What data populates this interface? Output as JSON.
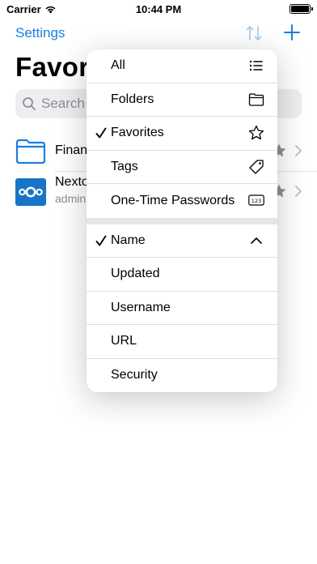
{
  "status_bar": {
    "carrier": "Carrier",
    "time": "10:44 PM"
  },
  "nav": {
    "left_label": "Settings",
    "sort_icon": "sort-arrows-icon",
    "add_icon": "plus-icon",
    "accent_color": "#1a7fe0"
  },
  "title": "Favori",
  "search": {
    "placeholder": "Search"
  },
  "list": [
    {
      "title": "Finan",
      "subtitle": "",
      "icon": "folder-icon"
    },
    {
      "title": "Nexto",
      "subtitle": "admin",
      "icon": "nextcloud-icon"
    }
  ],
  "menu": {
    "filter_items": [
      {
        "label": "All",
        "checked": false,
        "icon": "list-icon"
      },
      {
        "label": "Folders",
        "checked": false,
        "icon": "folder-outline-icon"
      },
      {
        "label": "Favorites",
        "checked": true,
        "icon": "star-outline-icon"
      },
      {
        "label": "Tags",
        "checked": false,
        "icon": "tag-icon"
      },
      {
        "label": "One-Time Passwords",
        "checked": false,
        "icon": "otp-123-icon"
      }
    ],
    "sort_items": [
      {
        "label": "Name",
        "checked": true,
        "icon": "chevron-up-icon"
      },
      {
        "label": "Updated",
        "checked": false,
        "icon": ""
      },
      {
        "label": "Username",
        "checked": false,
        "icon": ""
      },
      {
        "label": "URL",
        "checked": false,
        "icon": ""
      },
      {
        "label": "Security",
        "checked": false,
        "icon": ""
      }
    ]
  }
}
